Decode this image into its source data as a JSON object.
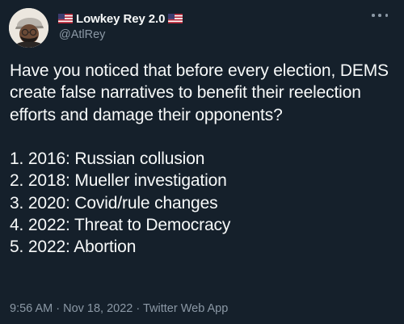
{
  "tweet": {
    "display_name": "Lowkey Rey 2.0",
    "handle": "@AtlRey",
    "flag_icon": "us-flag-icon",
    "more_icon": "more-options-icon",
    "text_intro": "Have you noticed that before every election, DEMS create false narratives to benefit their reelection efforts and damage their opponents?",
    "list": [
      "1. 2016: Russian collusion",
      "2. 2018: Mueller investigation",
      "3. 2020: Covid/rule changes",
      "4. 2022: Threat to Democracy",
      "5. 2022: Abortion"
    ],
    "time": "9:56 AM",
    "date": "Nov 18, 2022",
    "source": "Twitter Web App",
    "separator": " · "
  },
  "colors": {
    "background": "#15202b",
    "text": "#f7f9f9",
    "secondary_text": "#8b98a5"
  }
}
